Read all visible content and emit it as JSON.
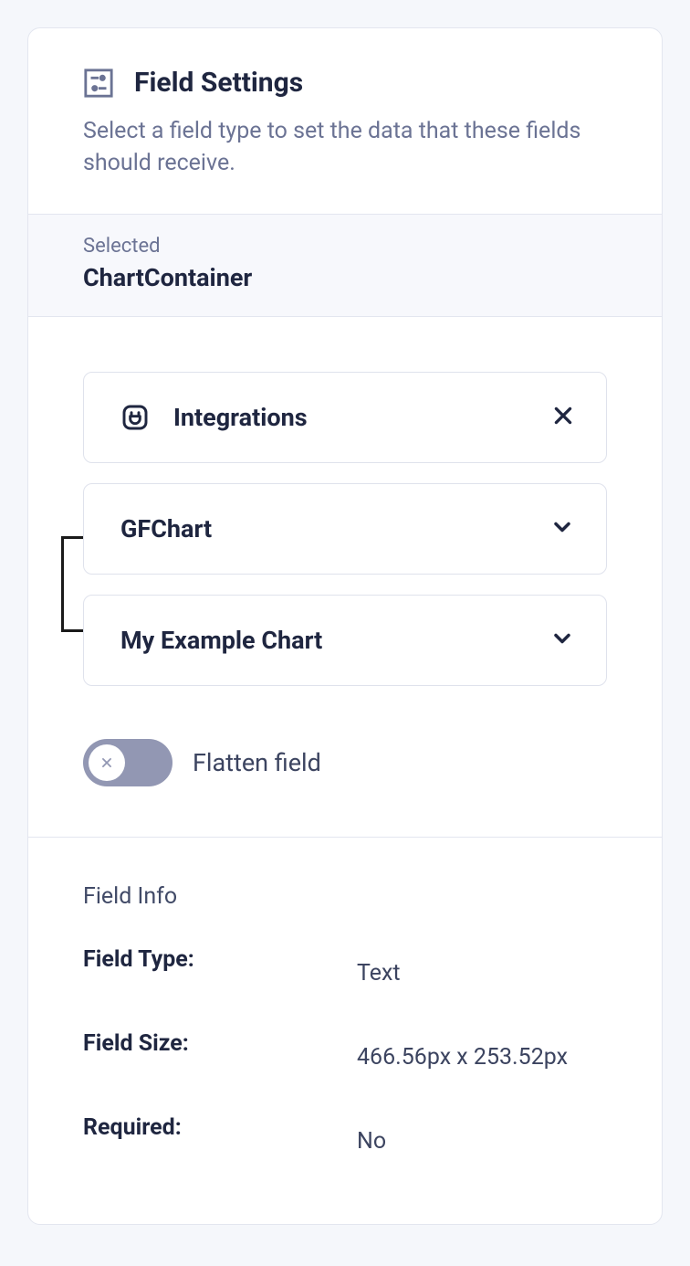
{
  "header": {
    "title": "Field Settings",
    "subtitle": "Select a field type to set the data that these fields should receive."
  },
  "selected": {
    "label": "Selected",
    "value": "ChartContainer"
  },
  "options": {
    "integrations": "Integrations",
    "gfchart": "GFChart",
    "example": "My Example Chart"
  },
  "toggle": {
    "label": "Flatten field"
  },
  "info": {
    "heading": "Field Info",
    "rows": {
      "type_key": "Field Type:",
      "type_val": "Text",
      "size_key": "Field Size:",
      "size_val": "466.56px x 253.52px",
      "req_key": "Required:",
      "req_val": "No"
    }
  }
}
